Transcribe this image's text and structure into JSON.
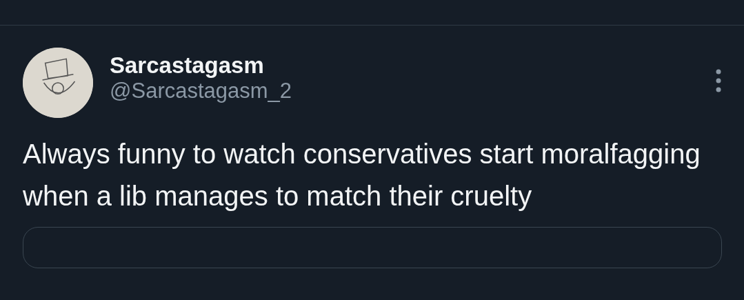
{
  "author": {
    "name": "Sarcastagasm",
    "handle": "@Sarcastagasm_2"
  },
  "tweet": {
    "text": "Always funny to watch conservatives start moralfagging when a lib manages to match their cruelty"
  }
}
